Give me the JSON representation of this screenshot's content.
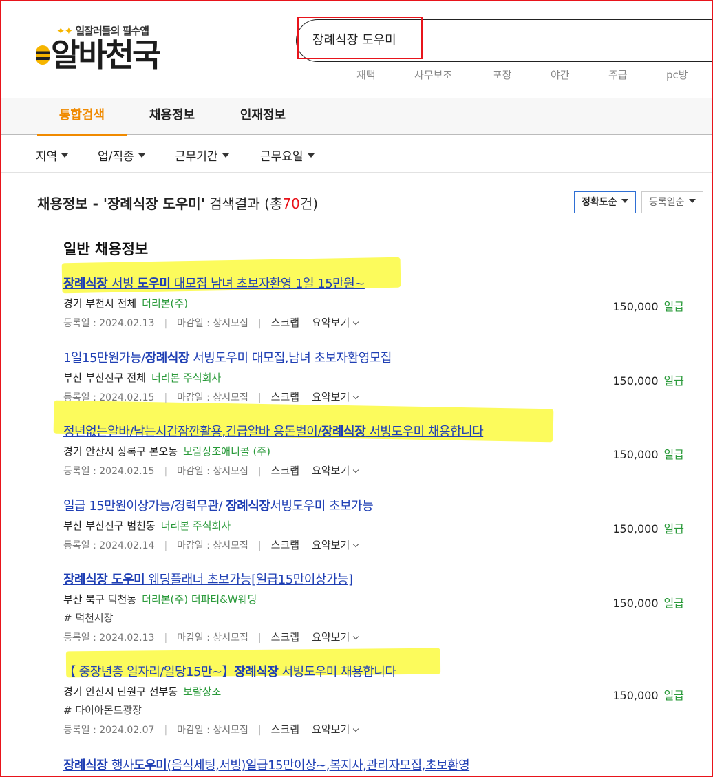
{
  "logo": {
    "tagline": "일잘러들의 필수앱",
    "name": "알바천국"
  },
  "search": {
    "value": "장례식장 도우미"
  },
  "keywords": [
    "재택",
    "사무보조",
    "포장",
    "야간",
    "주급",
    "pc방"
  ],
  "tabs": [
    {
      "label": "통합검색",
      "active": true
    },
    {
      "label": "채용정보",
      "active": false
    },
    {
      "label": "인재정보",
      "active": false
    }
  ],
  "filters": [
    "지역",
    "업/직종",
    "근무기간",
    "근무요일"
  ],
  "results": {
    "prefix": "채용정보 - '장례식장 도우미'",
    "label": " 검색결과 (총",
    "count": "70",
    "suffix": "건)"
  },
  "sort": {
    "accuracy": "정확도순",
    "date": "등록일순"
  },
  "section_title": "일반 채용정보",
  "listing_labels": {
    "reg_prefix": "등록일 : ",
    "deadline": "마감일 : 상시모집",
    "scrap": "스크랩",
    "summary": "요약보기"
  },
  "listings": [
    {
      "title_bold": "장례식장 ",
      "title_mid": "서빙 ",
      "title_bold2": "도우미",
      "title_rest": " 대모집 남녀 초보자환영 1일 15만원~",
      "location": "경기 부천시 전체",
      "company": "더리본(주)",
      "tag": "",
      "reg_date": "2024.02.13",
      "pay": "150,000",
      "pay_unit": "일급"
    },
    {
      "title_bold": "",
      "title_mid": "1일15만원가능/",
      "title_bold2": "장례식장",
      "title_rest": " 서빙도우미 대모집,남녀 초보자환영모집",
      "location": "부산 부산진구 전체",
      "company": "더리본 주식회사",
      "tag": "",
      "reg_date": "2024.02.15",
      "pay": "150,000",
      "pay_unit": "일급"
    },
    {
      "title_bold": "",
      "title_mid": "정년없는알바/남는시간잠깐활용,긴급알바 용돈벌이/",
      "title_bold2": "장례식장",
      "title_rest": " 서빙도우미 채용합니다",
      "location": "경기 안산시 상록구 본오동",
      "company": "보람상조애니콜 (주)",
      "tag": "",
      "reg_date": "2024.02.15",
      "pay": "150,000",
      "pay_unit": "일급"
    },
    {
      "title_bold": "",
      "title_mid": "일급 15만원이상가능/경력무관/ ",
      "title_bold2": "장례식장",
      "title_rest": "서빙도우미 초보가능",
      "location": "부산 부산진구 범천동",
      "company": "더리본 주식회사",
      "tag": "",
      "reg_date": "2024.02.14",
      "pay": "150,000",
      "pay_unit": "일급"
    },
    {
      "title_bold": "장례식장 ",
      "title_mid": "",
      "title_bold2": "도우미",
      "title_rest": " 웨딩플래너 초보가능[일급15만이상가능]",
      "location": "부산 북구 덕천동",
      "company": "더리본(주) 더파티&W웨딩",
      "tag": "# 덕천시장",
      "reg_date": "2024.02.13",
      "pay": "150,000",
      "pay_unit": "일급"
    },
    {
      "title_bold": "",
      "title_mid": "【 중장년층 일자리/일당15만~】",
      "title_bold2": "장례식장",
      "title_rest": " 서빙도우미 채용합니다",
      "location": "경기 안산시 단원구 선부동",
      "company": "보람상조",
      "tag": "# 다이아몬드광장",
      "reg_date": "2024.02.07",
      "pay": "150,000",
      "pay_unit": "일급"
    },
    {
      "title_bold": "장례식장 ",
      "title_mid": "행사",
      "title_bold2": "도우미",
      "title_rest": "(음식세팅,서빙)일급15만이상~,복지사,관리자모집,초보환영",
      "location": "",
      "company": "",
      "tag": "",
      "reg_date": "",
      "pay": "",
      "pay_unit": ""
    }
  ]
}
